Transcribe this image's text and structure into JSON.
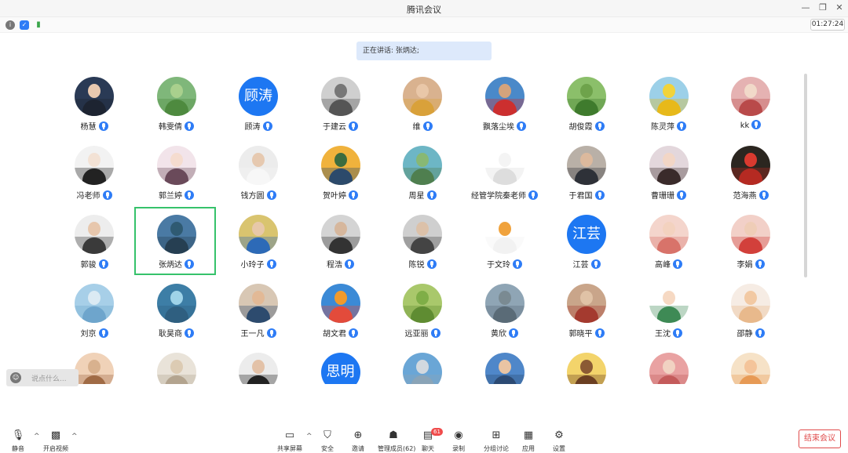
{
  "window": {
    "title": "腾讯会议",
    "timer": "01:27:24"
  },
  "speaking": {
    "label": "正在讲话: 张炳达;"
  },
  "participants": [
    {
      "name": "杨慧",
      "bg": "#2a3a55",
      "skin": "#e8c9b0",
      "body": "#1d2431"
    },
    {
      "name": "韩雯倩",
      "bg": "#7fb77a",
      "skin": "#a9d08d",
      "body": "#4e8a3f"
    },
    {
      "name": "顾涛",
      "text": "顾涛"
    },
    {
      "name": "于建云",
      "bg": "#cfcfcf",
      "skin": "#777777",
      "body": "#555555"
    },
    {
      "name": "维",
      "bg": "#d9b28f",
      "skin": "#e9c7a8",
      "body": "#d9a13a"
    },
    {
      "name": "飘落尘埃",
      "bg": "#4a89c9",
      "skin": "#d4a37c",
      "body": "#cc2f2f"
    },
    {
      "name": "胡俊霞",
      "bg": "#8bbf6a",
      "skin": "#6ea34b",
      "body": "#3f7b2d"
    },
    {
      "name": "陈灵萍",
      "bg": "#9cd0e8",
      "skin": "#f2d33a",
      "body": "#e7b91a"
    },
    {
      "name": "kk",
      "bg": "#e5b2b2",
      "skin": "#f1d9c9",
      "body": "#b94a4a"
    },
    {
      "name": "冯老师",
      "bg": "#f2f2f2",
      "skin": "#f3e2d5",
      "body": "#222222"
    },
    {
      "name": "郭兰婷",
      "bg": "#f2e4ea",
      "skin": "#f5dccf",
      "body": "#6a4a5a"
    },
    {
      "name": "钱方圆",
      "bg": "#ececec",
      "skin": "#e6c9b0",
      "body": "#f7f7f7"
    },
    {
      "name": "贺叶婷",
      "bg": "#f0b23c",
      "skin": "#3c6c3f",
      "body": "#2c4a6b"
    },
    {
      "name": "周星",
      "bg": "#6db6c5",
      "skin": "#88b874",
      "body": "#4f7f4f"
    },
    {
      "name": "经管学院秦老师",
      "bg": "#ffffff",
      "skin": "#f4f4f4",
      "body": "#dddddd"
    },
    {
      "name": "于君国",
      "bg": "#b9b0a7",
      "skin": "#dcb99d",
      "body": "#2e3138"
    },
    {
      "name": "曹珊珊",
      "bg": "#e3d7dc",
      "skin": "#f2d6c6",
      "body": "#3a2b2b"
    },
    {
      "name": "范海燕",
      "bg": "#2b2620",
      "skin": "#d93a2f",
      "body": "#b52a22"
    },
    {
      "name": "郭骏",
      "bg": "#ededed",
      "skin": "#e7c7ad",
      "body": "#3a3a3a"
    },
    {
      "name": "张炳达",
      "bg": "#4a7aa4",
      "skin": "#2f5a72",
      "body": "#263f52"
    },
    {
      "name": "小玲子",
      "bg": "#d9c46f",
      "skin": "#e7c8a8",
      "body": "#2d6ab7"
    },
    {
      "name": "程浩",
      "bg": "#d4d4d4",
      "skin": "#d6b79d",
      "body": "#333333"
    },
    {
      "name": "陈锐",
      "bg": "#cfcfcf",
      "skin": "#dcc1a9",
      "body": "#444444"
    },
    {
      "name": "于文玲",
      "bg": "#ffffff",
      "skin": "#f0a23c",
      "body": "#f2f2f2"
    },
    {
      "name": "江芸",
      "text": "江芸"
    },
    {
      "name": "高峰",
      "bg": "#f4d5cc",
      "skin": "#f3d2bf",
      "body": "#d8736a"
    },
    {
      "name": "李娟",
      "bg": "#f2d0c8",
      "skin": "#efcdb7",
      "body": "#d2403b"
    },
    {
      "name": "刘京",
      "bg": "#a7cfe8",
      "skin": "#dbeaf3",
      "body": "#6ea5cc"
    },
    {
      "name": "耿昊商",
      "bg": "#3d7ea6",
      "skin": "#9fd3e8",
      "body": "#2f5f80"
    },
    {
      "name": "王一凡",
      "bg": "#d8c7b4",
      "skin": "#e2b996",
      "body": "#2d4b6e"
    },
    {
      "name": "胡文君",
      "bg": "#3b8ad6",
      "skin": "#f09a2c",
      "body": "#e34b3b"
    },
    {
      "name": "远亚丽",
      "bg": "#a9c86b",
      "skin": "#7fae47",
      "body": "#5f8c32"
    },
    {
      "name": "黄欣",
      "bg": "#8fa5b5",
      "skin": "#7a8a92",
      "body": "#5a6b77"
    },
    {
      "name": "郭晓平",
      "bg": "#c9a58a",
      "skin": "#e0c2a6",
      "body": "#a43a2f"
    },
    {
      "name": "王沈",
      "bg": "#ffffff",
      "skin": "#f6d9c3",
      "body": "#3e8a55"
    },
    {
      "name": "邵静",
      "bg": "#f6ece4",
      "skin": "#f2c9a3",
      "body": "#e8b98c"
    },
    {
      "name": "",
      "bg": "#f0d2b8",
      "skin": "#d8b18e",
      "body": "#a06b45"
    },
    {
      "name": "",
      "bg": "#e9e3d9",
      "skin": "#dccbb3",
      "body": "#b3a48f"
    },
    {
      "name": "",
      "bg": "#ececec",
      "skin": "#e3c2a8",
      "body": "#222222"
    },
    {
      "name": "思明",
      "text": "思明"
    },
    {
      "name": "",
      "bg": "#6aa6d6",
      "skin": "#d2d9df",
      "body": "#8aa4b7"
    },
    {
      "name": "",
      "bg": "#4f87c9",
      "skin": "#e9c4a3",
      "body": "#2c4a73"
    },
    {
      "name": "",
      "bg": "#f3d46b",
      "skin": "#8b5a34",
      "body": "#6b3f22"
    },
    {
      "name": "",
      "bg": "#e9a2a2",
      "skin": "#f1d2c2",
      "body": "#c45b5b"
    },
    {
      "name": "",
      "bg": "#f6e2c7",
      "skin": "#f4c49a",
      "body": "#e79a55"
    }
  ],
  "chat": {
    "placeholder": "说点什么...",
    "icon": "smile-icon"
  },
  "toolbar": {
    "mute": "静音",
    "video": "开启视频",
    "share": "共享屏幕",
    "security": "安全",
    "invite": "邀请",
    "members": "管理成员(62)",
    "chat": "聊天",
    "chat_badge": "61",
    "record": "录制",
    "breakout": "分组讨论",
    "apps": "应用",
    "settings": "设置",
    "end": "结束会议"
  },
  "colors": {
    "accent": "#1d77f2",
    "active_border": "#36c26b",
    "end_red": "#e04b4b"
  }
}
